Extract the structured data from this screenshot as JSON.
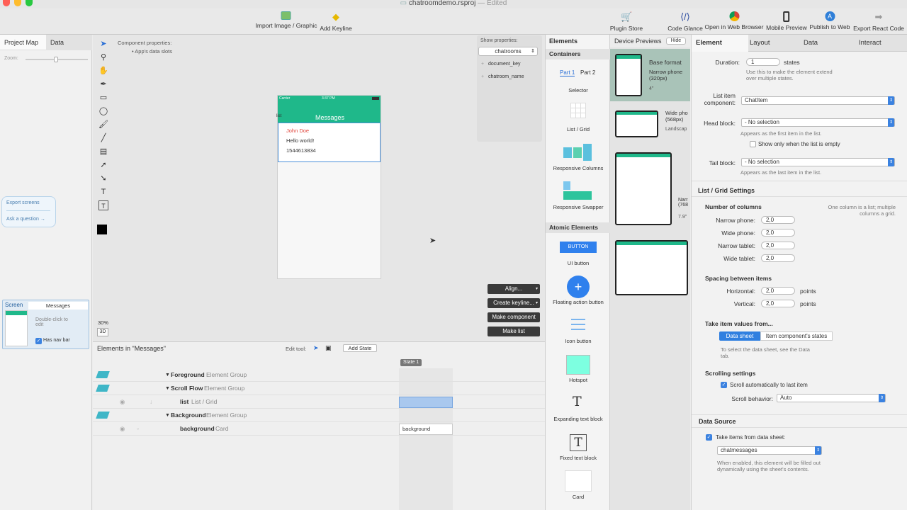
{
  "window": {
    "title": "chatroomdemo.rsproj",
    "title_suffix": "— Edited"
  },
  "toolbar": {
    "import_image": "Import Image / Graphic",
    "add_keyline": "Add Keyline",
    "plugin_store": "Plugin Store",
    "code_glance": "Code Glance",
    "open_browser": "Open in Web Browser",
    "mobile_preview": "Mobile Preview",
    "publish_web": "Publish to Web",
    "export_react": "Export React Code"
  },
  "left_panel": {
    "tabs": [
      "Project Map",
      "Data"
    ],
    "zoom_label": "Zoom:",
    "export_screens": "Export screens",
    "ask_question": "Ask a question →",
    "screen_card": {
      "label": "Screen",
      "name": "Messages",
      "hint": "Double-click to edit",
      "has_nav_bar": "Has nav bar"
    }
  },
  "canvas": {
    "component_properties": "Component properties:",
    "app_data_slots": "• App's data slots",
    "show_properties": "Show properties:",
    "selected_sheet": "chatrooms",
    "sheet_fields": [
      "document_key",
      "chatroom_name"
    ],
    "zoom": "30%",
    "mode_3d": "3D",
    "buttons": {
      "align": "Align...",
      "create_keyline": "Create keyline...",
      "make_component": "Make component",
      "make_list": "Make list"
    },
    "phone": {
      "carrier": "Carrier",
      "time": "3:37 PM",
      "nav_title": "Messages",
      "left_label": "list",
      "item_name": "John Doe",
      "item_text": "Hello world!",
      "item_time": "1544613834"
    }
  },
  "timeline": {
    "title": "Elements in \"Messages\"",
    "edit_tool": "Edit tool:",
    "add_state": "Add State",
    "state_label": "State 1",
    "rows": [
      {
        "name": "Foreground",
        "type": "Element Group"
      },
      {
        "name": "Scroll Flow",
        "type": "Element Group"
      },
      {
        "name": "list",
        "type": "List / Grid"
      },
      {
        "name": "Background",
        "type": "Element Group"
      },
      {
        "name": "background",
        "type": "Card"
      }
    ],
    "background_chip": "background"
  },
  "elements_panel": {
    "header": "Elements",
    "containers": "Containers",
    "part1": "Part 1",
    "part2": "Part 2",
    "selector": "Selector",
    "list_grid": "List / Grid",
    "responsive_columns": "Responsive Columns",
    "responsive_swapper": "Responsive Swapper",
    "atomic": "Atomic Elements",
    "button_text": "BUTTON",
    "ui_button": "UI button",
    "fab": "Floating action button",
    "icon_button": "Icon button",
    "hotspot": "Hotspot",
    "expanding_text": "Expanding text block",
    "fixed_text": "Fixed text block",
    "card": "Card"
  },
  "devices": {
    "header": "Device Previews",
    "hide": "Hide",
    "base_format": "Base format",
    "narrow_phone": "Narrow phone (320px)",
    "base_deg": "4\"",
    "wide_phone": "Wide pho (568px)",
    "landscape": "Landscap",
    "narrow_tablet": "Narr (768",
    "narrow_deg": "7.9\""
  },
  "properties": {
    "tabs": [
      "Element",
      "Layout",
      "Data",
      "Interact"
    ],
    "duration_label": "Duration:",
    "duration_value": "1",
    "duration_unit": "states",
    "duration_hint": "Use this to make the element extend over multiple states.",
    "list_item_label": "List item component:",
    "list_item_value": "ChatItem",
    "head_label": "Head block:",
    "head_value": "- No selection",
    "head_hint": "Appears as the first item in the list.",
    "only_empty": "Show only when the list is empty",
    "tail_label": "Tail block:",
    "tail_value": "- No selection",
    "tail_hint": "Appears as the last item in the list.",
    "list_grid_settings": "List / Grid Settings",
    "num_columns": "Number of columns",
    "columns_hint": "One column is a list; multiple columns a grid.",
    "narrow_phone": "Narrow phone:",
    "wide_phone": "Wide phone:",
    "narrow_tablet": "Narrow tablet:",
    "wide_tablet": "Wide tablet:",
    "col_value": "2,0",
    "spacing": "Spacing between items",
    "horizontal": "Horizontal:",
    "vertical": "Vertical:",
    "spacing_value": "2,0",
    "points": "points",
    "take_values": "Take item values from...",
    "data_sheet": "Data sheet",
    "item_states": "Item component's states",
    "select_hint": "To select the data sheet, see the Data tab.",
    "scrolling": "Scrolling settings",
    "scroll_auto": "Scroll automatically to last item",
    "scroll_behavior": "Scroll behavior:",
    "scroll_value": "Auto",
    "data_source": "Data Source",
    "take_items": "Take items from data sheet:",
    "sheet_value": "chatmessages",
    "enabled_hint": "When enabled, this element will be filled out dynamically using the sheet's contents."
  },
  "colors": {
    "accent": "#1fb88a",
    "blue": "#3b82e0",
    "name_red": "#e0443b"
  }
}
